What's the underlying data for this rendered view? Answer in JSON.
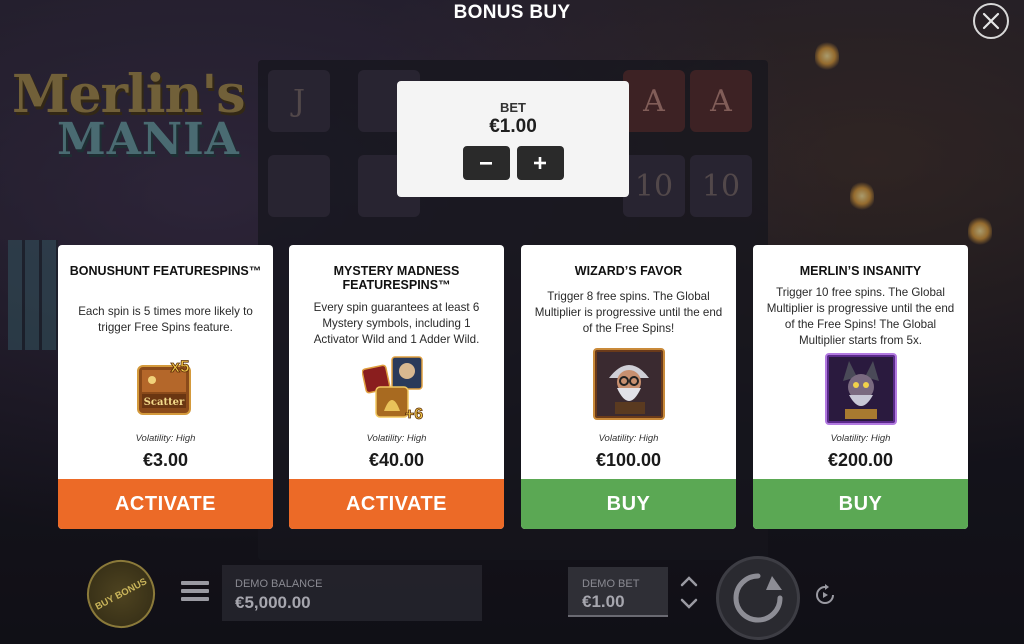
{
  "header": {
    "title": "BONUS BUY"
  },
  "background": {
    "logo_line1": "Merlin's",
    "logo_line2": "MANIA",
    "reel_symbols": [
      "J",
      "A",
      "A",
      "10",
      "10"
    ]
  },
  "bet": {
    "label": "BET",
    "value": "€1.00",
    "minus_label": "−",
    "plus_label": "+"
  },
  "cards": [
    {
      "title": "BONUSHUNT FEATURESPINS™",
      "description": "Each spin is 5 times more likely to trigger Free Spins feature.",
      "icon": "scatter-x5-icon",
      "icon_text_top": "x5",
      "icon_text_main": "Scatter",
      "volatility": "Volatility: High",
      "price": "€3.00",
      "button_label": "ACTIVATE",
      "button_color": "#ec6a27"
    },
    {
      "title": "MYSTERY MADNESS FEATURESPINS™",
      "description": "Every spin guarantees at least 6 Mystery symbols, including 1 Activator Wild and 1 Adder Wild.",
      "icon": "mystery-symbols-icon",
      "icon_text_badge": "+6",
      "volatility": "Volatility: High",
      "price": "€40.00",
      "button_label": "ACTIVATE",
      "button_color": "#ec6a27"
    },
    {
      "title": "WIZARD’S FAVOR",
      "description": "Trigger 8 free spins. The Global Multiplier is progressive until the end of the Free Spins!",
      "icon": "wizard-portrait-icon",
      "volatility": "Volatility: High",
      "price": "€100.00",
      "button_label": "BUY",
      "button_color": "#5ba854"
    },
    {
      "title": "MERLIN’S INSANITY",
      "description": "Trigger 10 free spins. The Global Multiplier is progressive until the end of the Free Spins! The Global Multiplier starts from 5x.",
      "icon": "merlin-insanity-portrait-icon",
      "volatility": "Volatility: High",
      "price": "€200.00",
      "button_label": "BUY",
      "button_color": "#5ba854"
    }
  ],
  "bottom_bar": {
    "buy_bonus_label": "BUY BONUS",
    "balance_label": "DEMO BALANCE",
    "balance_value": "€5,000.00",
    "bet_label": "DEMO BET",
    "bet_value": "€1.00"
  }
}
